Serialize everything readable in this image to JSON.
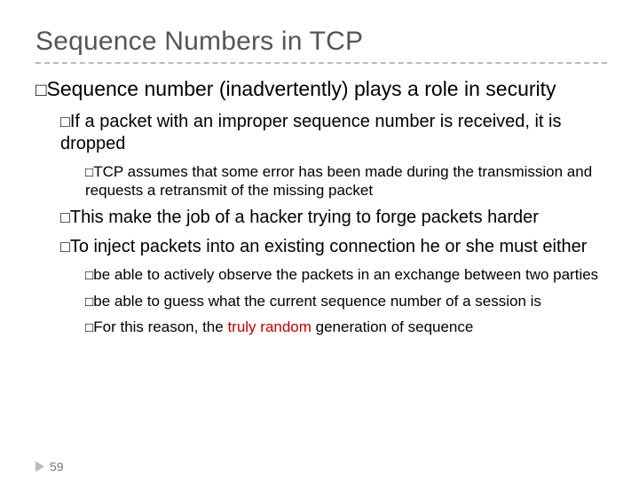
{
  "title": "Sequence Numbers in TCP",
  "bullet": "□",
  "lvl1_a_pre": "Sequence",
  "lvl1_a_rest": " number (inadvertently) plays a role in security",
  "lvl2_a_pre": "If",
  "lvl2_a_rest": " a packet with an improper sequence number is received, it is dropped",
  "lvl3_a_pre": "TCP",
  "lvl3_a_rest": " assumes that some error has been made during the transmission and requests a retransmit of the missing packet",
  "lvl2_b_pre": "This",
  "lvl2_b_rest": " make the job of a hacker trying to forge packets harder",
  "lvl2_c_pre": "To",
  "lvl2_c_rest": " inject packets into an existing connection he or she must either",
  "lvl3_b_pre": "be",
  "lvl3_b_rest": " able to actively observe the packets in an exchange between two parties",
  "lvl3_c_pre": "be",
  "lvl3_c_rest": " able to guess what the current sequence number of a session is",
  "lvl3_d_pre": "For",
  "lvl3_d_mid": " this reason, the ",
  "lvl3_d_red": "truly random",
  "lvl3_d_rest": " generation of sequence",
  "page_number": "59"
}
